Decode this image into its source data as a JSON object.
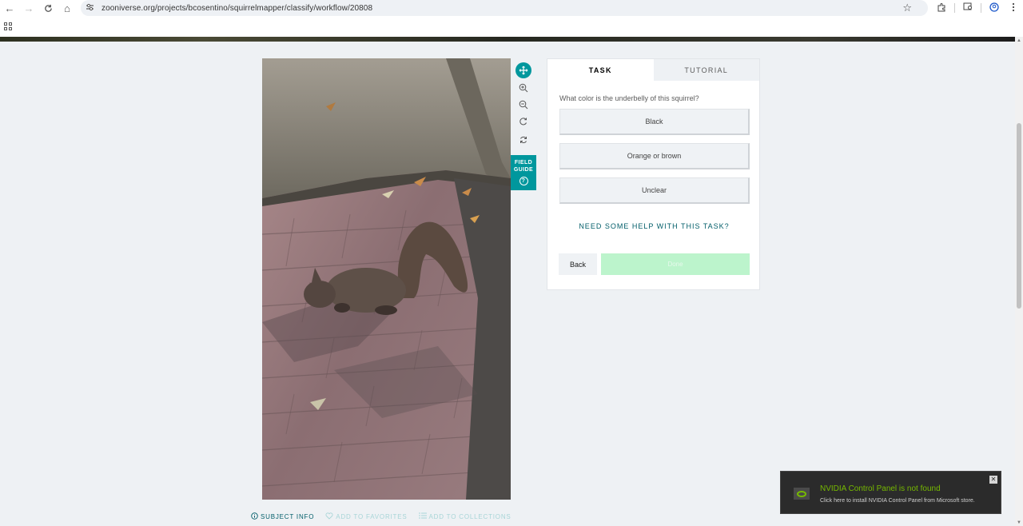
{
  "browser": {
    "url": "zooniverse.org/projects/bcosentino/squirrelmapper/classify/workflow/20808",
    "back_glyph": "←",
    "forward_glyph": "→",
    "reload_glyph": "C",
    "home_glyph": "⌂",
    "star_glyph": "☆"
  },
  "toolbar": {
    "field_guide_label_1": "FIELD",
    "field_guide_label_2": "GUIDE",
    "help_glyph": "?"
  },
  "task": {
    "tabs": [
      {
        "label": "TASK"
      },
      {
        "label": "TUTORIAL"
      }
    ],
    "question": "What color is the underbelly of this squirrel?",
    "answers": [
      {
        "label": "Black"
      },
      {
        "label": "Orange or brown"
      },
      {
        "label": "Unclear"
      }
    ],
    "help_link": "NEED SOME HELP WITH THIS TASK?",
    "back_label": "Back",
    "done_label": "Done"
  },
  "subject_links": {
    "info": "SUBJECT INFO",
    "favorites": "ADD TO FAVORITES",
    "collections": "ADD TO COLLECTIONS"
  },
  "notification": {
    "title": "NVIDIA Control Panel is not found",
    "body": "Click here to install NVIDIA Control Panel from Microsoft store.",
    "close_glyph": "✕"
  },
  "colors": {
    "teal": "#00979d",
    "teal_dark": "#005d69",
    "done_disabled": "#bcf4cc",
    "nvidia_green": "#76b900"
  }
}
